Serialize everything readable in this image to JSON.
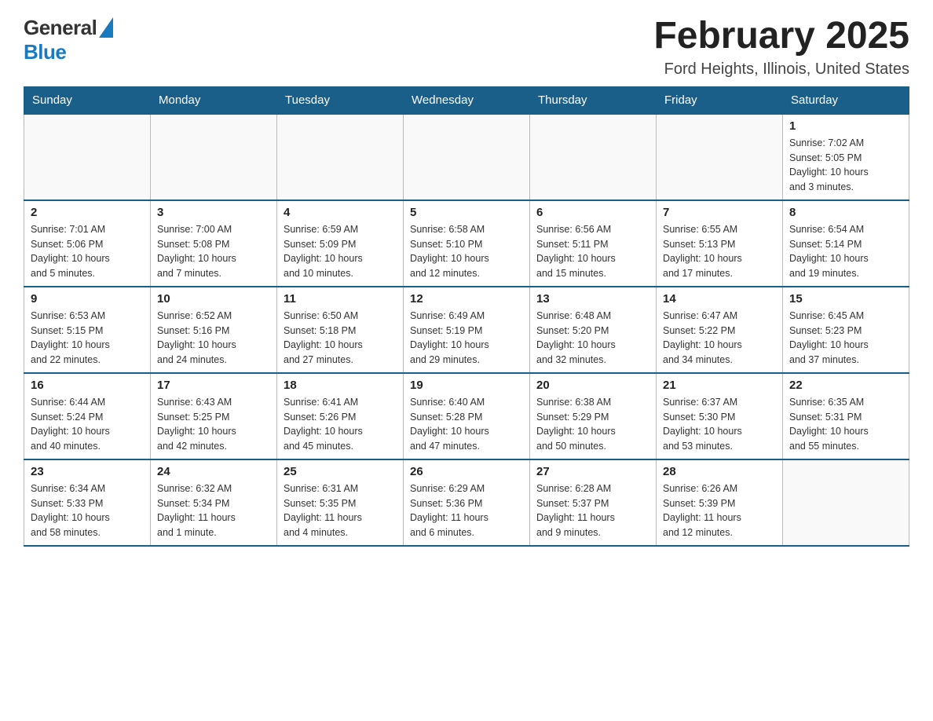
{
  "header": {
    "logo": {
      "text_general": "General",
      "text_blue": "Blue",
      "alt": "GeneralBlue Logo"
    },
    "title": "February 2025",
    "location": "Ford Heights, Illinois, United States"
  },
  "calendar": {
    "days_of_week": [
      "Sunday",
      "Monday",
      "Tuesday",
      "Wednesday",
      "Thursday",
      "Friday",
      "Saturday"
    ],
    "weeks": [
      [
        {
          "day": "",
          "info": ""
        },
        {
          "day": "",
          "info": ""
        },
        {
          "day": "",
          "info": ""
        },
        {
          "day": "",
          "info": ""
        },
        {
          "day": "",
          "info": ""
        },
        {
          "day": "",
          "info": ""
        },
        {
          "day": "1",
          "info": "Sunrise: 7:02 AM\nSunset: 5:05 PM\nDaylight: 10 hours\nand 3 minutes."
        }
      ],
      [
        {
          "day": "2",
          "info": "Sunrise: 7:01 AM\nSunset: 5:06 PM\nDaylight: 10 hours\nand 5 minutes."
        },
        {
          "day": "3",
          "info": "Sunrise: 7:00 AM\nSunset: 5:08 PM\nDaylight: 10 hours\nand 7 minutes."
        },
        {
          "day": "4",
          "info": "Sunrise: 6:59 AM\nSunset: 5:09 PM\nDaylight: 10 hours\nand 10 minutes."
        },
        {
          "day": "5",
          "info": "Sunrise: 6:58 AM\nSunset: 5:10 PM\nDaylight: 10 hours\nand 12 minutes."
        },
        {
          "day": "6",
          "info": "Sunrise: 6:56 AM\nSunset: 5:11 PM\nDaylight: 10 hours\nand 15 minutes."
        },
        {
          "day": "7",
          "info": "Sunrise: 6:55 AM\nSunset: 5:13 PM\nDaylight: 10 hours\nand 17 minutes."
        },
        {
          "day": "8",
          "info": "Sunrise: 6:54 AM\nSunset: 5:14 PM\nDaylight: 10 hours\nand 19 minutes."
        }
      ],
      [
        {
          "day": "9",
          "info": "Sunrise: 6:53 AM\nSunset: 5:15 PM\nDaylight: 10 hours\nand 22 minutes."
        },
        {
          "day": "10",
          "info": "Sunrise: 6:52 AM\nSunset: 5:16 PM\nDaylight: 10 hours\nand 24 minutes."
        },
        {
          "day": "11",
          "info": "Sunrise: 6:50 AM\nSunset: 5:18 PM\nDaylight: 10 hours\nand 27 minutes."
        },
        {
          "day": "12",
          "info": "Sunrise: 6:49 AM\nSunset: 5:19 PM\nDaylight: 10 hours\nand 29 minutes."
        },
        {
          "day": "13",
          "info": "Sunrise: 6:48 AM\nSunset: 5:20 PM\nDaylight: 10 hours\nand 32 minutes."
        },
        {
          "day": "14",
          "info": "Sunrise: 6:47 AM\nSunset: 5:22 PM\nDaylight: 10 hours\nand 34 minutes."
        },
        {
          "day": "15",
          "info": "Sunrise: 6:45 AM\nSunset: 5:23 PM\nDaylight: 10 hours\nand 37 minutes."
        }
      ],
      [
        {
          "day": "16",
          "info": "Sunrise: 6:44 AM\nSunset: 5:24 PM\nDaylight: 10 hours\nand 40 minutes."
        },
        {
          "day": "17",
          "info": "Sunrise: 6:43 AM\nSunset: 5:25 PM\nDaylight: 10 hours\nand 42 minutes."
        },
        {
          "day": "18",
          "info": "Sunrise: 6:41 AM\nSunset: 5:26 PM\nDaylight: 10 hours\nand 45 minutes."
        },
        {
          "day": "19",
          "info": "Sunrise: 6:40 AM\nSunset: 5:28 PM\nDaylight: 10 hours\nand 47 minutes."
        },
        {
          "day": "20",
          "info": "Sunrise: 6:38 AM\nSunset: 5:29 PM\nDaylight: 10 hours\nand 50 minutes."
        },
        {
          "day": "21",
          "info": "Sunrise: 6:37 AM\nSunset: 5:30 PM\nDaylight: 10 hours\nand 53 minutes."
        },
        {
          "day": "22",
          "info": "Sunrise: 6:35 AM\nSunset: 5:31 PM\nDaylight: 10 hours\nand 55 minutes."
        }
      ],
      [
        {
          "day": "23",
          "info": "Sunrise: 6:34 AM\nSunset: 5:33 PM\nDaylight: 10 hours\nand 58 minutes."
        },
        {
          "day": "24",
          "info": "Sunrise: 6:32 AM\nSunset: 5:34 PM\nDaylight: 11 hours\nand 1 minute."
        },
        {
          "day": "25",
          "info": "Sunrise: 6:31 AM\nSunset: 5:35 PM\nDaylight: 11 hours\nand 4 minutes."
        },
        {
          "day": "26",
          "info": "Sunrise: 6:29 AM\nSunset: 5:36 PM\nDaylight: 11 hours\nand 6 minutes."
        },
        {
          "day": "27",
          "info": "Sunrise: 6:28 AM\nSunset: 5:37 PM\nDaylight: 11 hours\nand 9 minutes."
        },
        {
          "day": "28",
          "info": "Sunrise: 6:26 AM\nSunset: 5:39 PM\nDaylight: 11 hours\nand 12 minutes."
        },
        {
          "day": "",
          "info": ""
        }
      ]
    ]
  }
}
